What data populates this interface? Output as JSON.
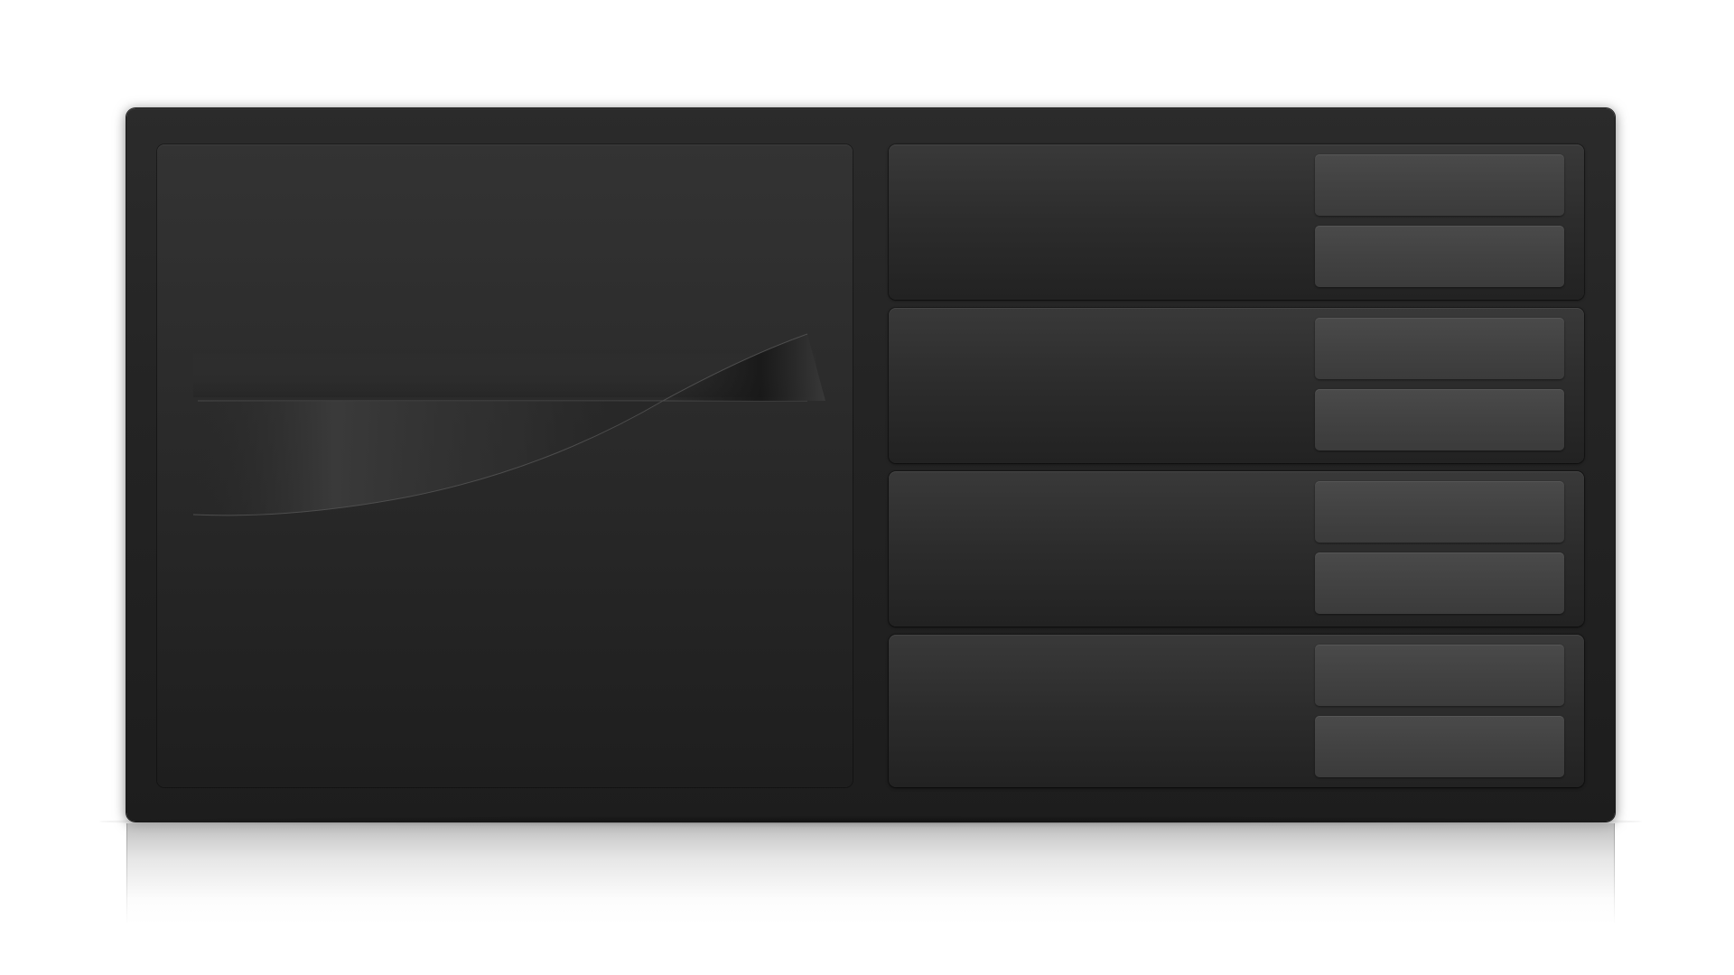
{
  "window": {
    "title": ""
  },
  "preview": {
    "label": ""
  },
  "rows": [
    {
      "primary_label": "",
      "secondary_label": ""
    },
    {
      "primary_label": "",
      "secondary_label": ""
    },
    {
      "primary_label": "",
      "secondary_label": ""
    },
    {
      "primary_label": "",
      "secondary_label": ""
    }
  ],
  "colors": {
    "device_body": "#242424",
    "panel": "#2c2c2c",
    "button": "#444444",
    "background": "#ffffff"
  }
}
